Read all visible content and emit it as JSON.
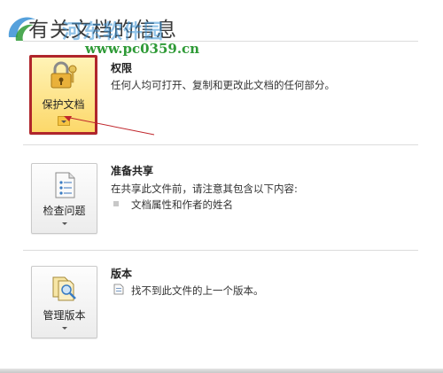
{
  "page": {
    "title": "有关文档的信息"
  },
  "watermark": {
    "brand": "河东软件园",
    "url": "www.pc0359.cn"
  },
  "permissions": {
    "button_label": "保护文档",
    "heading": "权限",
    "description": "任何人均可打开、复制和更改此文档的任何部分。"
  },
  "sharing": {
    "button_label": "检查问题",
    "heading": "准备共享",
    "description": "在共享此文件前，请注意其包含以下内容:",
    "items": [
      "文档属性和作者的姓名"
    ]
  },
  "versions": {
    "button_label": "管理版本",
    "heading": "版本",
    "description": "找不到此文件的上一个版本。"
  },
  "colors": {
    "highlight_border": "#b0262c",
    "protect_fill": "#fcd86a",
    "watermark_blue": "#3891d6",
    "watermark_green": "#2e9a36"
  }
}
